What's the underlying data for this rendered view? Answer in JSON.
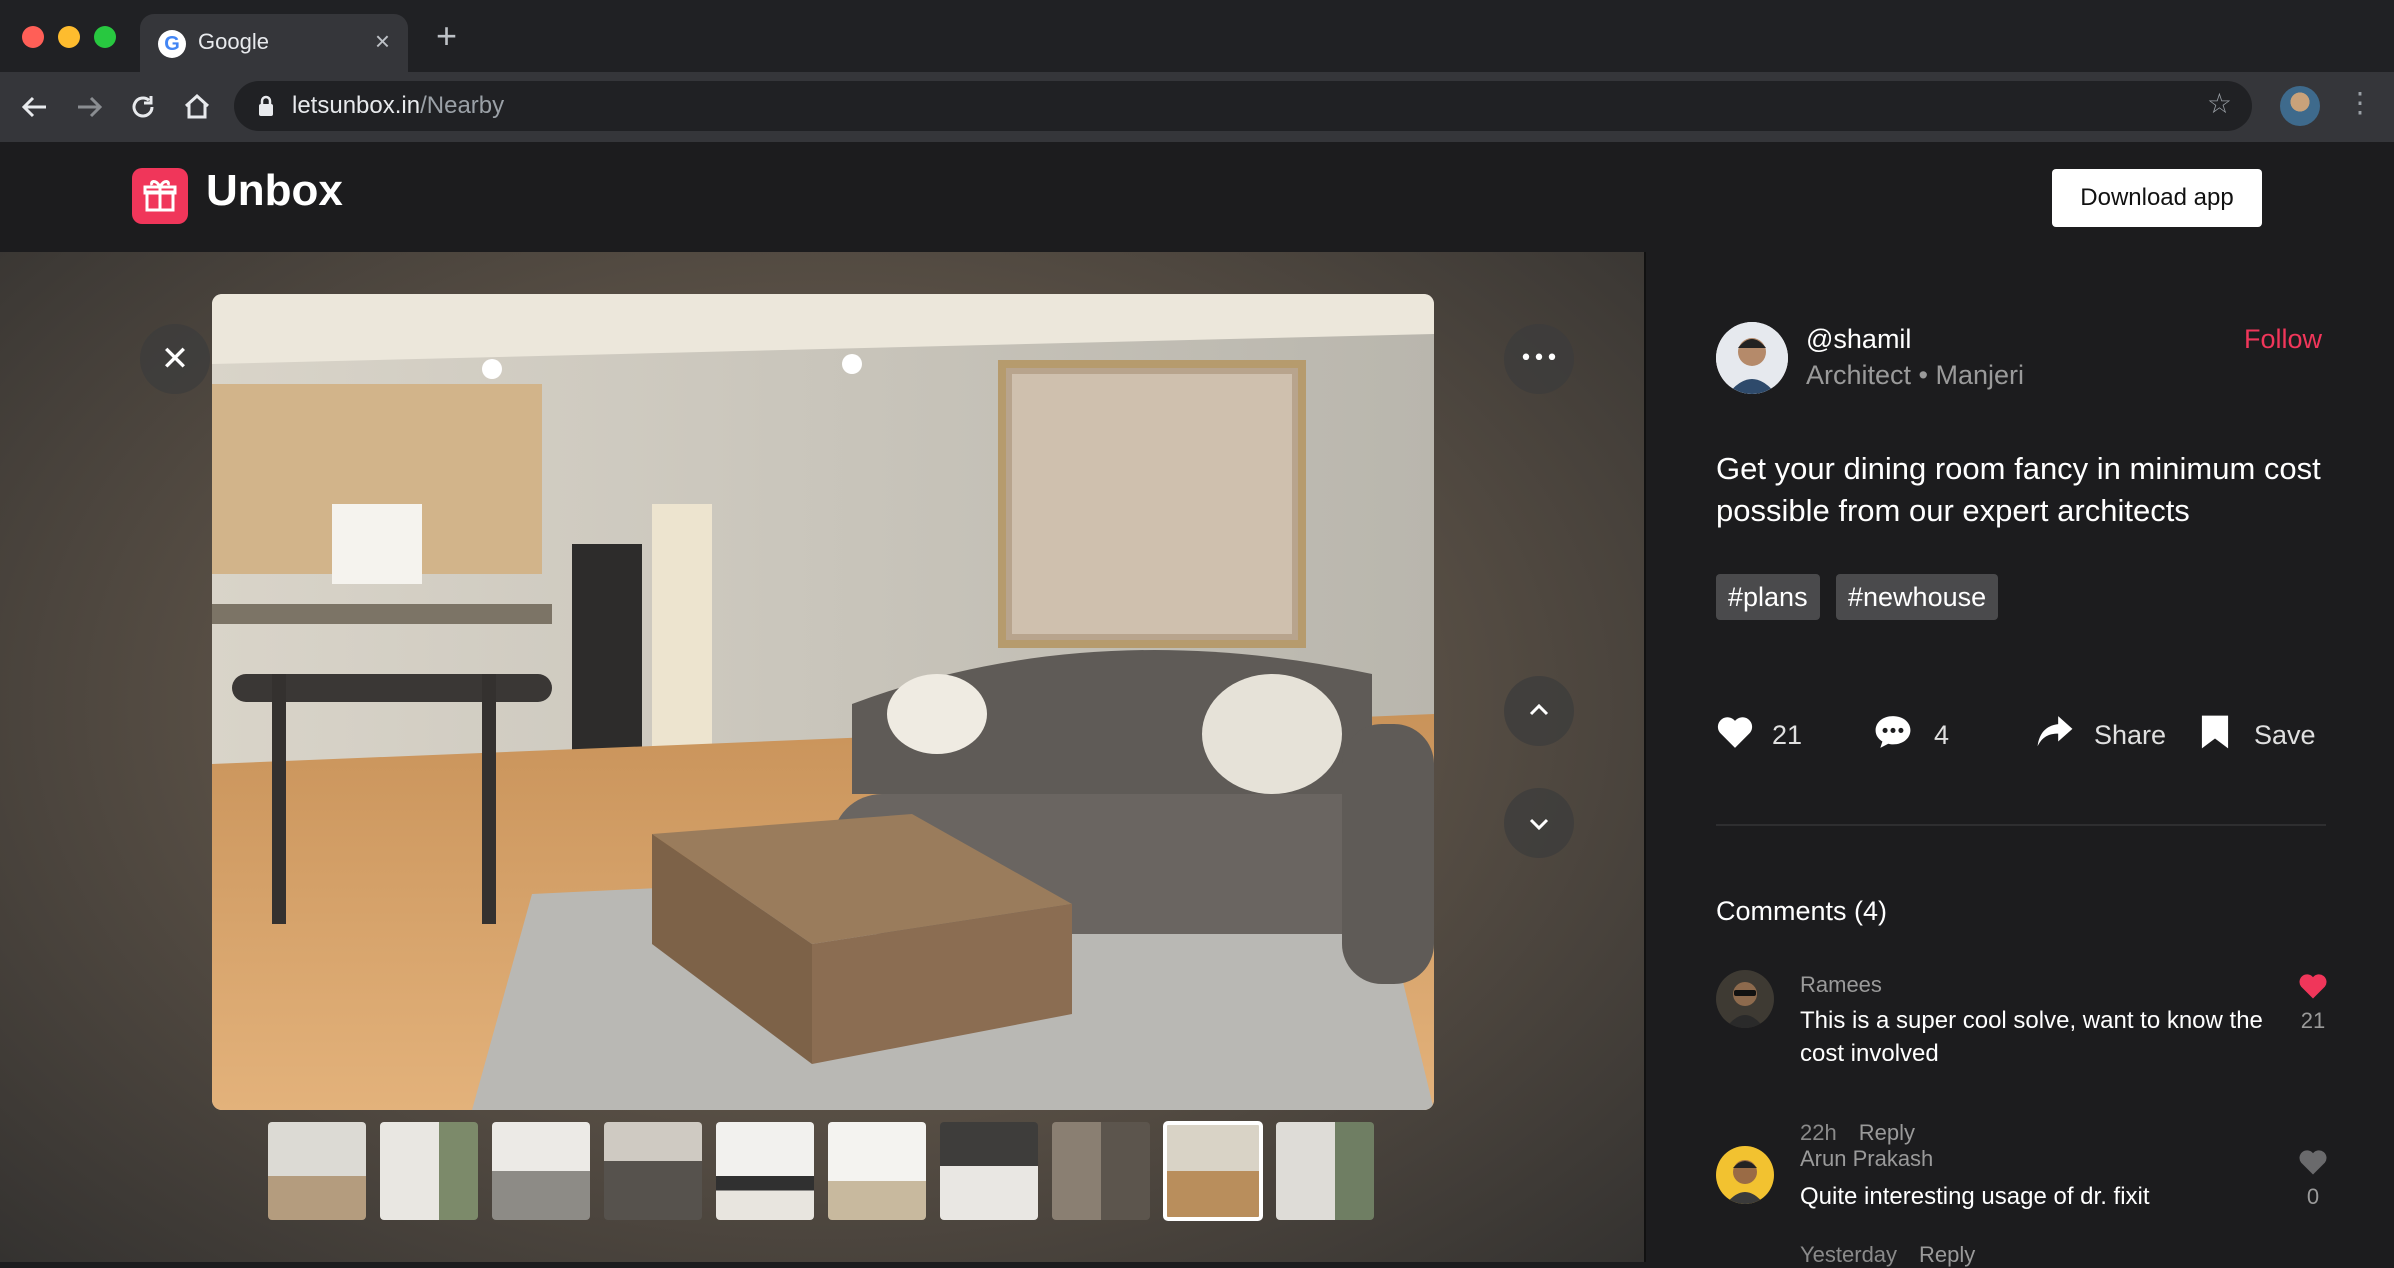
{
  "browser": {
    "tab_title": "Google",
    "tab_favicon": "G",
    "tab_close": "×",
    "new_tab": "+",
    "url_host": "letsunbox.in",
    "url_path": "/Nearby",
    "icons": [
      "back-icon",
      "forward-icon",
      "reload-icon",
      "home-icon",
      "lock-icon",
      "star-icon",
      "profile-avatar",
      "menu-icon"
    ]
  },
  "site": {
    "brand": "Unbox",
    "download_label": "Download app",
    "accent": "#f0365a"
  },
  "viewer": {
    "close_glyph": "✕",
    "more_glyph": "•••",
    "up_glyph": "⌃",
    "down_glyph": "⌄",
    "thumbnail_count": 10,
    "active_thumbnail": 9
  },
  "post": {
    "handle": "@shamil",
    "role": "Architect • Manjeri",
    "follow_label": "Follow",
    "caption": "Get your dining room fancy in minimum cost possible from our expert architects",
    "tags": [
      "#plans",
      "#newhouse"
    ],
    "likes": "21",
    "comments_count": "4",
    "share_label": "Share",
    "save_label": "Save"
  },
  "comments": {
    "title": "Comments (4)",
    "items": [
      {
        "name": "Ramees",
        "text": "This is a super cool solve, want to know the cost involved",
        "likes": "21",
        "liked": true,
        "time": "22h",
        "reply": "Reply"
      },
      {
        "name": "Arun Prakash",
        "text": "Quite interesting usage of dr. fixit",
        "likes": "0",
        "liked": false,
        "time": "Yesterday",
        "reply": "Reply"
      }
    ]
  }
}
